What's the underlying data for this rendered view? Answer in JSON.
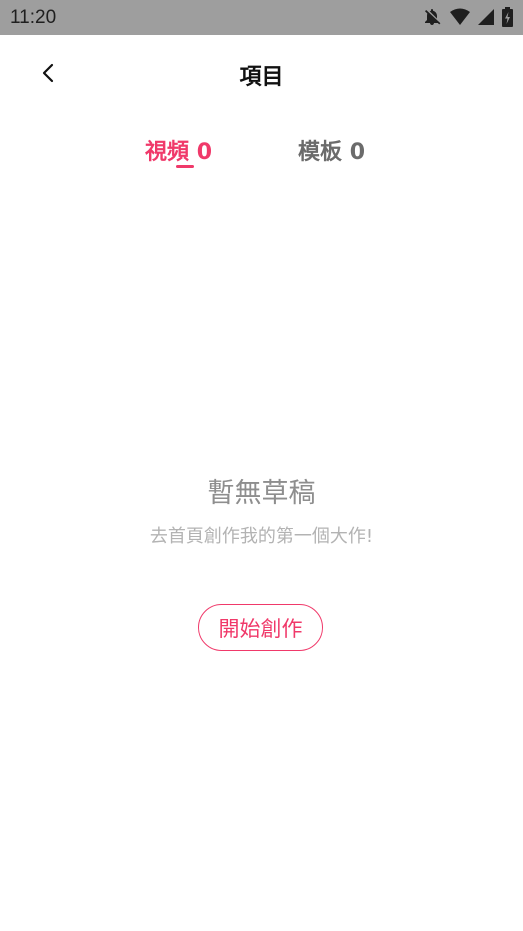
{
  "status_bar": {
    "time": "11:20",
    "icons": [
      "notifications-off-icon",
      "wifi-icon",
      "signal-icon",
      "battery-charging-icon"
    ]
  },
  "header": {
    "back_icon": "chevron-left-icon",
    "title": "項目"
  },
  "tabs": [
    {
      "label": "視頻",
      "count": "0",
      "active": true
    },
    {
      "label": "模板",
      "count": "0",
      "active": false
    }
  ],
  "empty_state": {
    "title": "暫無草稿",
    "subtitle": "去首頁創作我的第一個大作!",
    "button_label": "開始創作"
  },
  "colors": {
    "accent": "#f0396a",
    "status_bar": "#9e9e9e",
    "inactive_tab": "#6b6b6b",
    "empty_title": "#8e8e8e",
    "empty_subtitle": "#b3b3b3"
  }
}
